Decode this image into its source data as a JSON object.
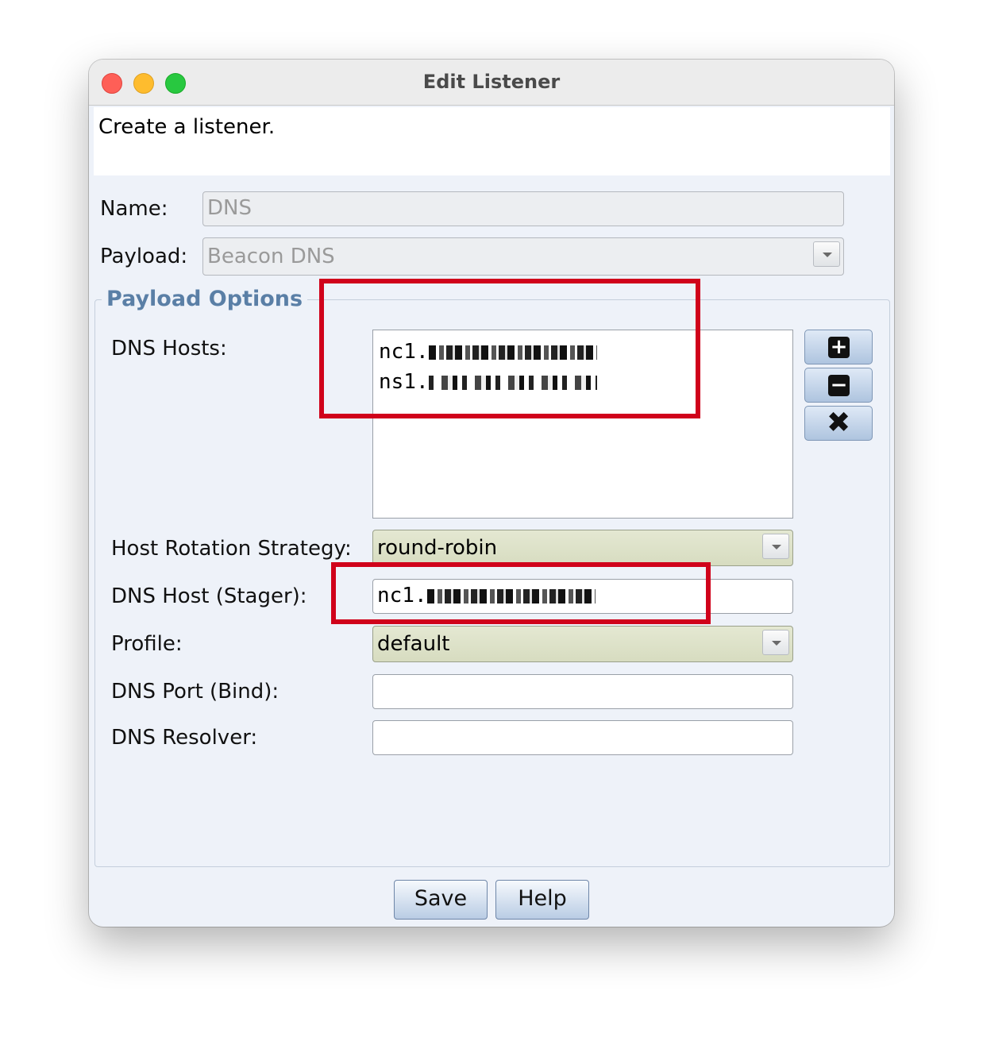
{
  "window": {
    "title": "Edit Listener",
    "description": "Create a listener."
  },
  "form": {
    "name_label": "Name:",
    "name_value": "DNS",
    "payload_label": "Payload:",
    "payload_value": "Beacon DNS"
  },
  "payload_options": {
    "legend": "Payload Options",
    "dns_hosts_label": "DNS Hosts:",
    "dns_hosts": [
      {
        "prefix": "nc1."
      },
      {
        "prefix": "ns1."
      }
    ],
    "host_rotation_label": "Host Rotation Strategy:",
    "host_rotation_value": "round-robin",
    "dns_host_stager_label": "DNS Host (Stager):",
    "dns_host_stager_prefix": "nc1.",
    "profile_label": "Profile:",
    "profile_value": "default",
    "dns_port_label": "DNS Port (Bind):",
    "dns_port_value": "",
    "dns_resolver_label": "DNS Resolver:",
    "dns_resolver_value": ""
  },
  "side_buttons": {
    "add_icon": "plus-icon",
    "remove_icon": "minus-icon",
    "clear_icon": "x-icon"
  },
  "buttons": {
    "save": "Save",
    "help": "Help"
  },
  "colors": {
    "highlight": "#d0021b",
    "legend": "#5a7fa6"
  }
}
